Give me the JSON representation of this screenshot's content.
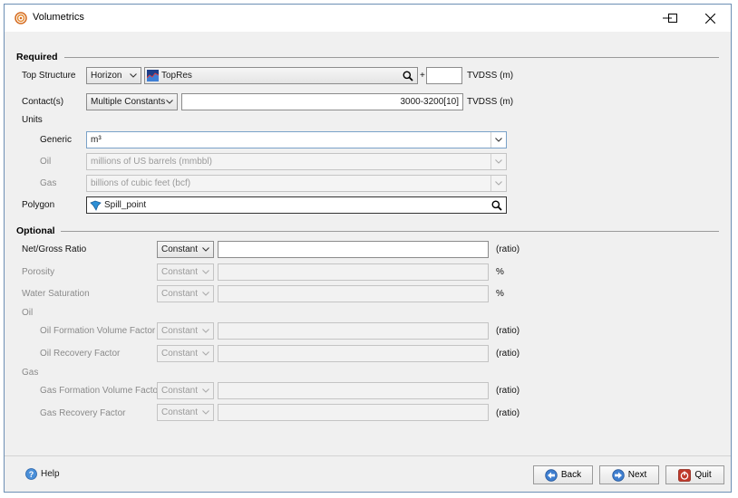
{
  "window": {
    "title": "Volumetrics"
  },
  "required": {
    "section_label": "Required",
    "top_structure": {
      "label": "Top Structure",
      "type_value": "Horizon",
      "object_name": "TopRes",
      "plus": "+",
      "offset_value": "",
      "unit": "TVDSS (m)"
    },
    "contacts": {
      "label": "Contact(s)",
      "type_value": "Multiple Constants",
      "value": "3000-3200[10]",
      "unit": "TVDSS (m)"
    },
    "units": {
      "label": "Units",
      "generic": {
        "label": "Generic",
        "value": "m³"
      },
      "oil": {
        "label": "Oil",
        "value": "millions of US barrels (mmbbl)"
      },
      "gas": {
        "label": "Gas",
        "value": "billions of cubic feet (bcf)"
      }
    },
    "polygon": {
      "label": "Polygon",
      "value": "Spill_point"
    }
  },
  "optional": {
    "section_label": "Optional",
    "net_gross": {
      "label": "Net/Gross Ratio",
      "type_value": "Constant",
      "value": "",
      "unit": "(ratio)"
    },
    "porosity": {
      "label": "Porosity",
      "type_value": "Constant",
      "value": "",
      "unit": "%"
    },
    "water_saturation": {
      "label": "Water Saturation",
      "type_value": "Constant",
      "value": "",
      "unit": "%"
    },
    "oil_group": "Oil",
    "oil_fvf": {
      "label": "Oil Formation Volume Factor",
      "type_value": "Constant",
      "value": "",
      "unit": "(ratio)"
    },
    "oil_rf": {
      "label": "Oil Recovery Factor",
      "type_value": "Constant",
      "value": "",
      "unit": "(ratio)"
    },
    "gas_group": "Gas",
    "gas_fvf": {
      "label": "Gas Formation Volume Factor",
      "type_value": "Constant",
      "value": "",
      "unit": "(ratio)"
    },
    "gas_rf": {
      "label": "Gas Recovery Factor",
      "type_value": "Constant",
      "value": "",
      "unit": "(ratio)"
    }
  },
  "footer": {
    "help": "Help",
    "back": "Back",
    "next": "Next",
    "quit": "Quit"
  },
  "colors": {
    "accent": "#2f6fb5",
    "title_bar": "#ffffff",
    "dialog_bg": "#f0f0f0"
  }
}
